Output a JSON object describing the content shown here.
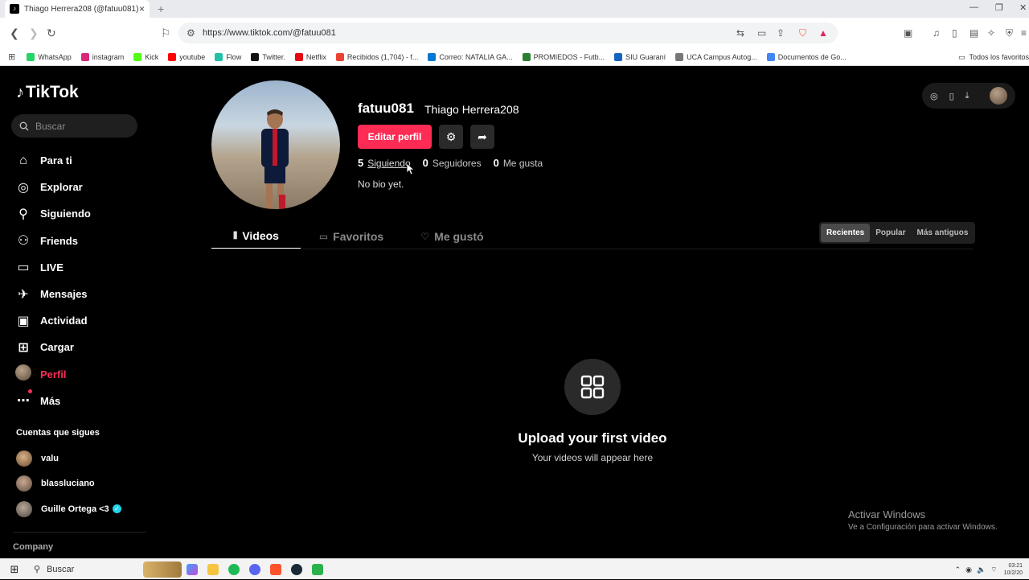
{
  "browser": {
    "tab_title": "Thiago Herrera208 (@fatuu081)",
    "url": "https://www.tiktok.com/@fatuu081",
    "bookmarks": [
      {
        "label": "WhatsApp",
        "color": "#25d366"
      },
      {
        "label": "instagram",
        "color": "#d62976"
      },
      {
        "label": "Kick",
        "color": "#53fc18"
      },
      {
        "label": "youtube",
        "color": "#ff0000"
      },
      {
        "label": "Flow",
        "color": "#22c1a6"
      },
      {
        "label": "Twitter.",
        "color": "#111111"
      },
      {
        "label": "Netflix",
        "color": "#e50914"
      },
      {
        "label": "Recibidos (1,704) - f...",
        "color": "#ea4335"
      },
      {
        "label": "Correo: NATALIA GA...",
        "color": "#0078d4"
      },
      {
        "label": "PROMIEDOS - Futb...",
        "color": "#2e7d32"
      },
      {
        "label": "SIU Guaraní",
        "color": "#1565c0"
      },
      {
        "label": "UCA Campus Autog...",
        "color": "#777777"
      },
      {
        "label": "Documentos de Go...",
        "color": "#4285f4"
      }
    ],
    "bookmarks_all": "Todos los favoritos"
  },
  "sidebar": {
    "logo": "TikTok",
    "search_placeholder": "Buscar",
    "items": [
      {
        "label": "Para ti",
        "icon": "home-icon"
      },
      {
        "label": "Explorar",
        "icon": "compass-icon"
      },
      {
        "label": "Siguiendo",
        "icon": "following-icon"
      },
      {
        "label": "Friends",
        "icon": "friends-icon"
      },
      {
        "label": "LIVE",
        "icon": "live-icon"
      },
      {
        "label": "Mensajes",
        "icon": "messages-icon"
      },
      {
        "label": "Actividad",
        "icon": "activity-icon"
      },
      {
        "label": "Cargar",
        "icon": "upload-icon"
      },
      {
        "label": "Perfil",
        "icon": "avatar"
      },
      {
        "label": "Más",
        "icon": "more-icon"
      }
    ],
    "following_heading": "Cuentas que sigues",
    "following_accounts": [
      "valu",
      "blassluciano",
      "Guille Ortega <3"
    ],
    "company": "Company"
  },
  "profile": {
    "username": "fatuu081",
    "nickname": "Thiago Herrera208",
    "edit_button": "Editar perfil",
    "following_count": "5",
    "following_label": "Siguiendo",
    "followers_count": "0",
    "followers_label": "Seguidores",
    "likes_count": "0",
    "likes_label": "Me gusta",
    "bio": "No bio yet."
  },
  "tabs": [
    "Videos",
    "Favoritos",
    "Me gustó"
  ],
  "sort_options": [
    "Recientes",
    "Popular",
    "Más antiguos"
  ],
  "empty_state": {
    "title": "Upload your first video",
    "subtitle": "Your videos will appear here"
  },
  "watermark": {
    "line1": "Activar Windows",
    "line2": "Ve a Configuración para activar Windows."
  },
  "taskbar": {
    "search_label": "Buscar",
    "time": "03:21",
    "date": "10/2/20"
  },
  "colors": {
    "accent": "#fe2c55",
    "background": "#000000"
  }
}
